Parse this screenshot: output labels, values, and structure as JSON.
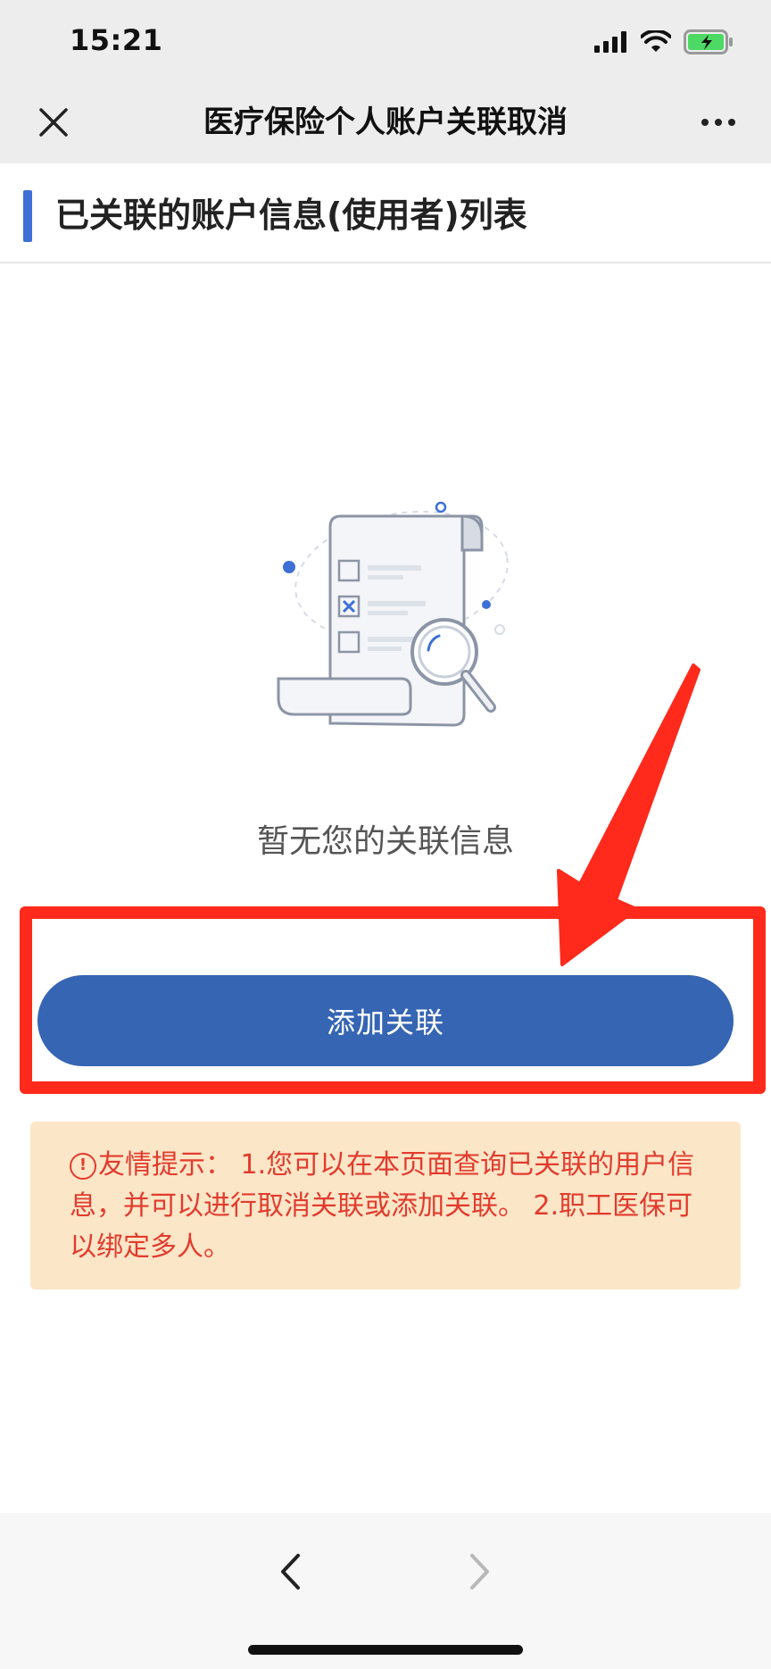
{
  "status_bar": {
    "time": "15:21",
    "icons": [
      "signal-icon",
      "wifi-icon",
      "battery-charging-icon"
    ]
  },
  "title_bar": {
    "title": "医疗保险个人账户关联取消",
    "close_icon": "close-icon",
    "more_icon": "more-icon"
  },
  "section": {
    "title": "已关联的账户信息(使用者)列表"
  },
  "empty_state": {
    "illustration_icon": "empty-list-illustration",
    "message": "暂无您的关联信息"
  },
  "actions": {
    "add_label": "添加关联"
  },
  "tip": {
    "icon": "warning-circle-icon",
    "icon_glyph": "!",
    "text": "友情提示： 1.您可以在本页面查询已关联的用户信息，并可以进行取消关联或添加关联。 2.职工医保可以绑定多人。"
  },
  "bottom_nav": {
    "back_icon": "chevron-left-icon",
    "forward_icon": "chevron-right-icon"
  },
  "colors": {
    "accent": "#3565b3",
    "section_bar": "#3e6fd6",
    "annotation_red": "#ff2a1c",
    "tip_bg": "#fbe6c7",
    "tip_text": "#e23b2e"
  }
}
